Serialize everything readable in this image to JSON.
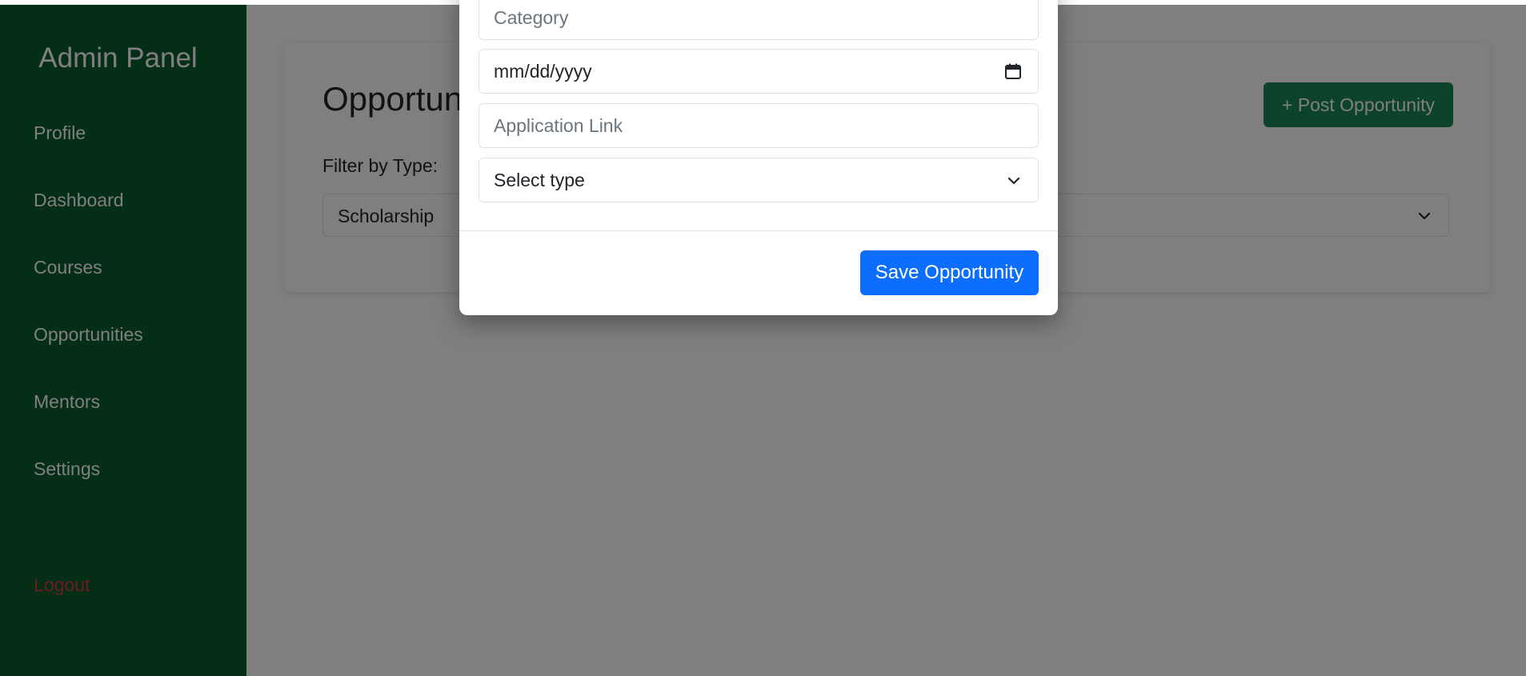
{
  "sidebar": {
    "brand": "Admin Panel",
    "items": [
      {
        "label": "Profile"
      },
      {
        "label": "Dashboard"
      },
      {
        "label": "Courses"
      },
      {
        "label": "Opportunities"
      },
      {
        "label": "Mentors"
      },
      {
        "label": "Settings"
      }
    ],
    "logout": "Logout"
  },
  "main": {
    "title": "Opportunities",
    "post_button": "+ Post Opportunity",
    "filter_label": "Filter by Type:",
    "filter_value": "Scholarship"
  },
  "modal": {
    "category_placeholder": "Category",
    "date_placeholder": "mm/dd/yyyy",
    "link_placeholder": "Application Link",
    "type_select": "Select type",
    "save_button": "Save Opportunity"
  },
  "colors": {
    "sidebar_bg": "#0a5c2c",
    "post_button": "#198754",
    "save_button": "#0d6efd",
    "logout": "#dc3545"
  },
  "icons": {
    "calendar": "calendar-icon",
    "chevron": "chevron-down-icon"
  }
}
